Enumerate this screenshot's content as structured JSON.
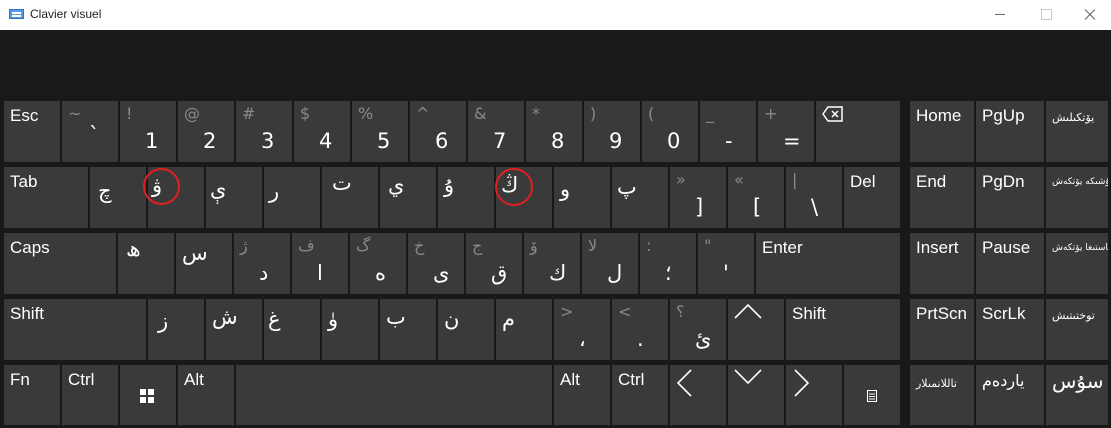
{
  "window": {
    "title": "Clavier visuel"
  },
  "row1": {
    "esc": "Esc",
    "numbers": [
      {
        "shift": "~",
        "base": "`"
      },
      {
        "shift": "!",
        "base": "1"
      },
      {
        "shift": "@",
        "base": "2"
      },
      {
        "shift": "#",
        "base": "3"
      },
      {
        "shift": "$",
        "base": "4"
      },
      {
        "shift": "%",
        "base": "5"
      },
      {
        "shift": "^",
        "base": "6"
      },
      {
        "shift": "&",
        "base": "7"
      },
      {
        "shift": "*",
        "base": "8"
      },
      {
        "shift": ")",
        "base": "9"
      },
      {
        "shift": "(",
        "base": "0"
      },
      {
        "shift": "_",
        "base": "-"
      },
      {
        "shift": "+",
        "base": "="
      }
    ],
    "nav": [
      "Home",
      "PgUp",
      "يۆتكىلىش"
    ]
  },
  "row2": {
    "tab": "Tab",
    "letters": [
      "چ",
      "ۋ",
      "ې",
      "ر",
      "ت",
      "ي",
      "ۇ",
      "ڭ",
      "و",
      "پ"
    ],
    "brackets": [
      {
        "shift": "»",
        "base": "]"
      },
      {
        "shift": "«",
        "base": "["
      },
      {
        "shift": "|",
        "base": "\\"
      }
    ],
    "del": "Del",
    "nav": [
      "End",
      "PgDn",
      "تۇشىكە يۆتكەش"
    ]
  },
  "row3": {
    "caps": "Caps",
    "letters": [
      {
        "shift": "",
        "base": "ھ"
      },
      {
        "shift": "",
        "base": "س"
      },
      {
        "shift": "ژ",
        "base": "د"
      },
      {
        "shift": "ف",
        "base": "ا"
      },
      {
        "shift": "گ",
        "base": "ە"
      },
      {
        "shift": "خ",
        "base": "ى"
      },
      {
        "shift": "ج",
        "base": "ق"
      },
      {
        "shift": "ۆ",
        "base": "ك"
      },
      {
        "shift": "لا",
        "base": "ل"
      },
      {
        "shift": ":",
        "base": "؛"
      },
      {
        "shift": "\"",
        "base": "'"
      }
    ],
    "enter": "Enter",
    "nav": [
      "Insert",
      "Pause",
      "ئاستىغا يۆتكەش"
    ]
  },
  "row4": {
    "shift": "Shift",
    "letters": [
      {
        "shift": "",
        "base": "ز"
      },
      {
        "shift": "",
        "base": "ش"
      },
      {
        "shift": "",
        "base": "غ"
      },
      {
        "shift": "",
        "base": "ۈ"
      },
      {
        "shift": "",
        "base": "ب"
      },
      {
        "shift": "",
        "base": "ن"
      },
      {
        "shift": "",
        "base": "م"
      },
      {
        "shift": ">",
        "base": "،"
      },
      {
        "shift": "<",
        "base": "."
      },
      {
        "shift": "؟",
        "base": "ئ"
      }
    ],
    "shift_right": "Shift",
    "nav": [
      "PrtScn",
      "ScrLk",
      "توختىتىش"
    ]
  },
  "row5": {
    "fn": "Fn",
    "ctrl": "Ctrl",
    "alt": "Alt",
    "alt_right": "Alt",
    "ctrl_right": "Ctrl",
    "nav": [
      "تاللانمىلار",
      "يارده‌م",
      "سۇس"
    ]
  },
  "colors": {
    "key": "#3a3a3a",
    "background": "#191919",
    "highlight_circle": "#e02020"
  }
}
